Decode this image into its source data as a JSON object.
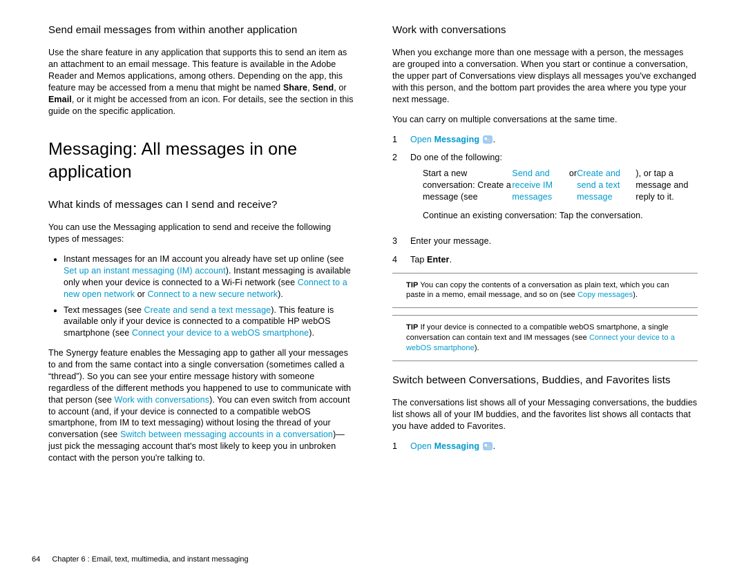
{
  "left": {
    "h1": "Send email messages from within another application",
    "p1a": "Use the share feature in any application that supports this to send an item as an attachment to an email message. This feature is available in the Adobe Reader and Memos applications, among others. Depending on the app, this feature may be accessed from a menu that might be named ",
    "p1b1": "Share",
    "p1c1": ", ",
    "p1b2": "Send",
    "p1c2": ", or ",
    "p1b3": "Email",
    "p1d": ", or it might be accessed from an icon. For details, see the section in this guide on the specific application.",
    "h2": "Messaging: All messages in one application",
    "h3": "What kinds of messages can I send and receive?",
    "p2": "You can use the Messaging application to send and receive the following types of messages:",
    "b1a": "Instant messages for an IM account you already have set up online (see ",
    "b1l1": "Set up an instant messaging (IM) account",
    "b1b": "). Instant messaging is available only when your device is connected to a Wi-Fi network (see ",
    "b1l2": "Connect to a new open network",
    "b1c": " or ",
    "b1l3": "Connect to a new secure network",
    "b1d": ").",
    "b2a": "Text messages (see ",
    "b2l1": "Create and send a text message",
    "b2b": "). This feature is available only if your device is connected to a compatible HP webOS smartphone (see ",
    "b2l2": "Connect your device to a webOS smartphone",
    "b2c": ").",
    "p3a": "The Synergy feature enables the Messaging app to gather all your messages to and from the same contact into a single conversation (sometimes called a “thread”). So you can see your entire message history with someone regardless of the different methods you happened to use to communicate with that person (see ",
    "p3l1": "Work with conversations",
    "p3b": "). You can even switch from account to account (and, if your device is connected to a compatible webOS smartphone, from IM to text messaging) without losing the thread of your conversation (see ",
    "p3l2": "Switch between messaging accounts in a conversation",
    "p3c": ")—just pick the messaging account that's most likely to keep you in unbroken contact with the person you're talking to."
  },
  "right": {
    "h1": "Work with conversations",
    "p1": "When you exchange more than one message with a person, the messages are grouped into a conversation. When you start or continue a conversation, the upper part of Conversations view displays all messages you've exchanged with this person, and the bottom part provides the area where you type your next message.",
    "p2": "You can carry on multiple conversations at the same time.",
    "s1n": "1",
    "s1a": "Open ",
    "s1b": "Messaging",
    "s1c": ".",
    "s2n": "2",
    "s2a": "Do one of the following:",
    "s2b1a": "Start a new conversation: Create a message (see ",
    "s2b1l1": "Send and receive IM messages",
    "s2b1b": " or ",
    "s2b1l2": "Create and send a text message",
    "s2b1c": "), or tap a message and reply to it.",
    "s2b2": "Continue an existing conversation: Tap the conversation.",
    "s3n": "3",
    "s3a": "Enter your message.",
    "s4n": "4",
    "s4a": "Tap ",
    "s4b": "Enter",
    "s4c": ".",
    "tip1a": "TIP",
    "tip1b": " You can copy the contents of a conversation as plain text, which you can paste in a memo, email message, and so on (see ",
    "tip1l": "Copy messages",
    "tip1c": ").",
    "tip2a": "TIP",
    "tip2b": " If your device is connected to a compatible webOS smartphone, a single conversation can contain text and IM messages (see ",
    "tip2l": "Connect your device to a webOS smartphone",
    "tip2c": ").",
    "h2": "Switch between Conversations, Buddies, and Favorites lists",
    "p3": "The conversations list shows all of your Messaging conversations, the buddies list shows all of your IM buddies, and the favorites list shows all contacts that you have added to Favorites.",
    "s5n": "1",
    "s5a": "Open ",
    "s5b": "Messaging",
    "s5c": "."
  },
  "footer": {
    "page": "64",
    "chap": "Chapter 6 : Email, text, multimedia, and instant messaging"
  }
}
